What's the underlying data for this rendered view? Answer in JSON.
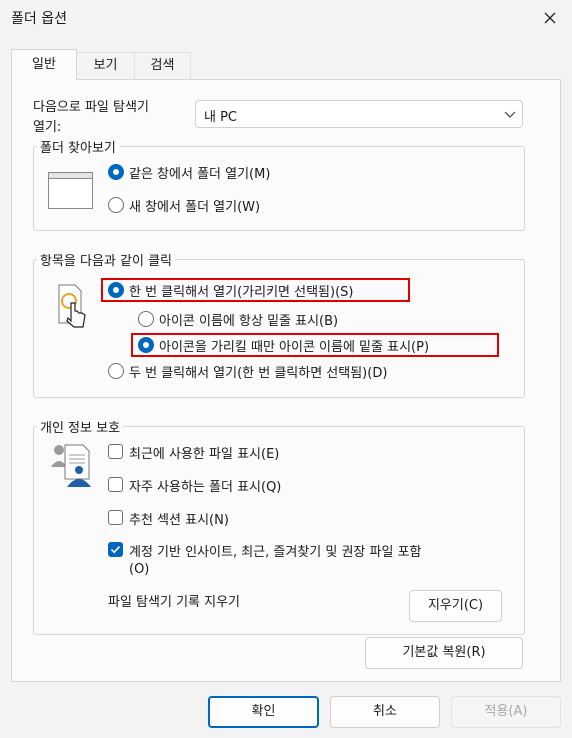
{
  "dialog": {
    "title": "폴더 옵션"
  },
  "tabs": [
    {
      "label": "일반"
    },
    {
      "label": "보기"
    },
    {
      "label": "검색"
    }
  ],
  "open_explorer": {
    "label_line1": "다음으로 파일 탐색기",
    "label_line2": "열기:",
    "value": "내 PC"
  },
  "browse_folders": {
    "title": "폴더 찾아보기",
    "options": [
      {
        "label": "같은 창에서 폴더 열기(M)",
        "selected": true
      },
      {
        "label": "새 창에서 폴더 열기(W)",
        "selected": false
      }
    ]
  },
  "click_items": {
    "title": "항목을 다음과 같이 클릭",
    "single_click": "한 번 클릭해서 열기(가리키면 선택됨)(S)",
    "underline_always": "아이콘 이름에 항상 밑줄 표시(B)",
    "underline_hover": "아이콘을 가리킬 때만 아이콘 이름에 밑줄 표시(P)",
    "double_click": "두 번 클릭해서 열기(한 번 클릭하면 선택됨)(D)"
  },
  "privacy": {
    "title": "개인 정보 보호",
    "options": [
      {
        "label": "최근에 사용한 파일 표시(E)",
        "checked": false
      },
      {
        "label": "자주 사용하는 폴더 표시(Q)",
        "checked": false
      },
      {
        "label": "추천 섹션 표시(N)",
        "checked": false
      },
      {
        "label": "계정 기반 인사이트, 최근, 즐겨찾기 및 권장 파일 포함",
        "label_line2": "(O)",
        "checked": true
      }
    ],
    "clear_history_label": "파일 탐색기 기록 지우기",
    "clear_button": "지우기(C)"
  },
  "restore_defaults": "기본값 복원(R)",
  "footer": {
    "ok": "확인",
    "cancel": "취소",
    "apply": "적용(A)"
  },
  "colors": {
    "accent": "#0067c0",
    "highlight_box": "#e00000"
  }
}
